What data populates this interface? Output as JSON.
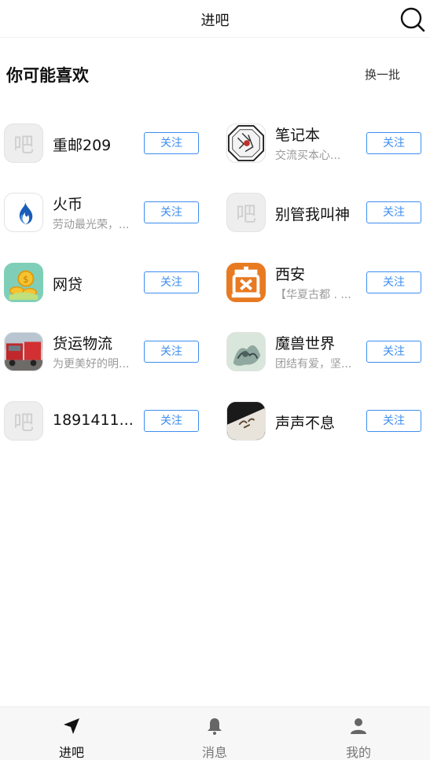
{
  "header": {
    "title": "进吧"
  },
  "section": {
    "title": "你可能喜欢",
    "refresh_label": "换一批"
  },
  "follow_label": "关注",
  "placeholder_glyph": "吧",
  "items": [
    {
      "name": "重邮209",
      "desc": "",
      "avatar": "placeholder"
    },
    {
      "name": "笔记本",
      "desc": "交流买本心...",
      "avatar": "notebook-logo"
    },
    {
      "name": "火币",
      "desc": "劳动最光荣，...",
      "avatar": "huobi-logo"
    },
    {
      "name": "别管我叫神",
      "desc": "",
      "avatar": "placeholder"
    },
    {
      "name": "网贷",
      "desc": "",
      "avatar": "coins-logo"
    },
    {
      "name": "西安",
      "desc": "【华夏古都 . ...",
      "avatar": "xian-logo"
    },
    {
      "name": "货运物流",
      "desc": "为更美好的明...",
      "avatar": "truck-photo"
    },
    {
      "name": "魔兽世界",
      "desc": "团结有爱，坚...",
      "avatar": "warcraft-art"
    },
    {
      "name": "1891411...",
      "desc": "",
      "avatar": "placeholder"
    },
    {
      "name": "声声不息",
      "desc": "",
      "avatar": "calligraphy-photo"
    }
  ],
  "tabs": [
    {
      "label": "进吧",
      "icon": "navigation-arrow-icon",
      "active": true
    },
    {
      "label": "消息",
      "icon": "bell-icon",
      "active": false
    },
    {
      "label": "我的",
      "icon": "person-icon",
      "active": false
    }
  ],
  "colors": {
    "accent": "#3d8ef0",
    "tabbar_bg": "#f7f7f7"
  }
}
